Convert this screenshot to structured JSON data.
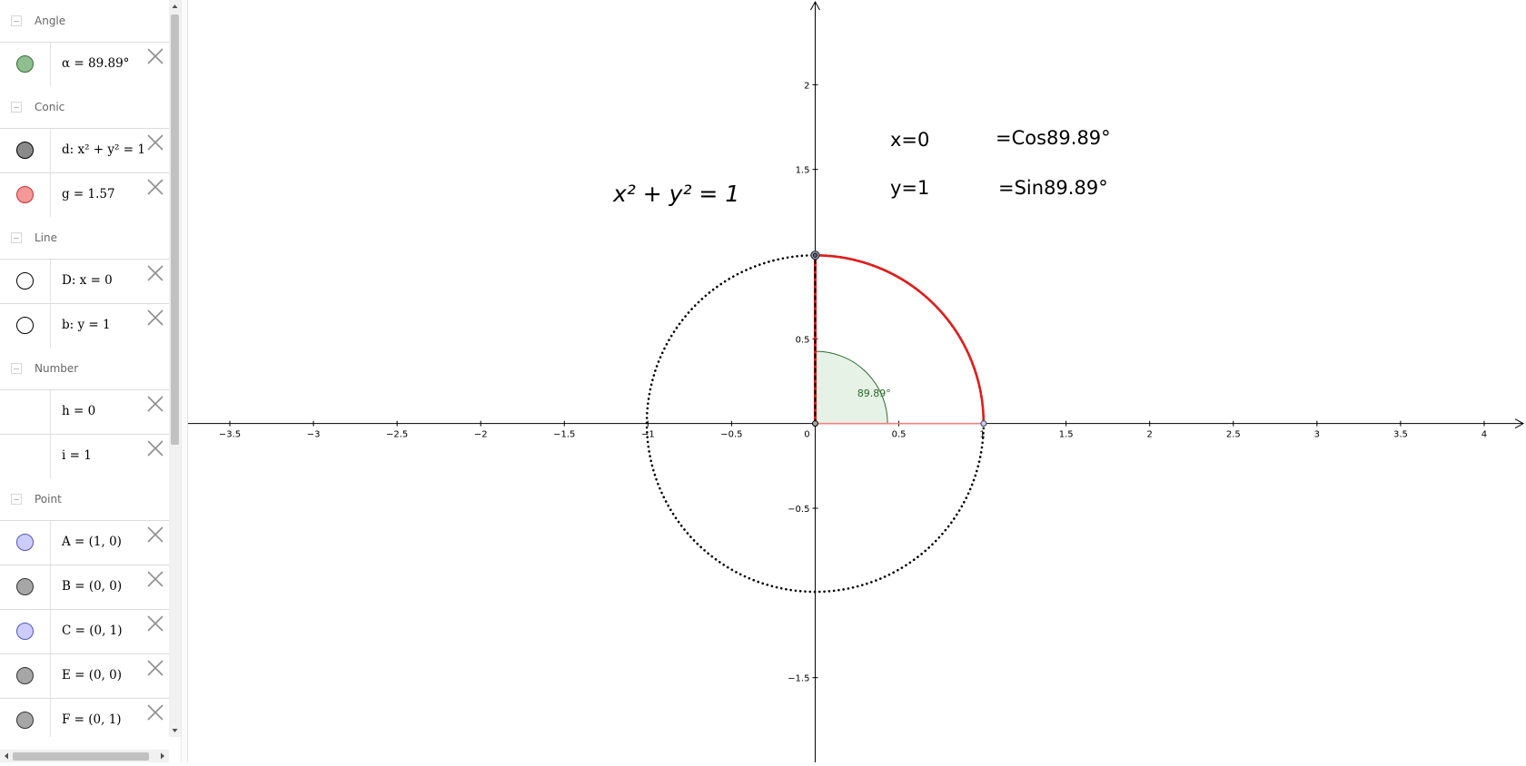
{
  "algebra": {
    "groups": [
      {
        "title": "Angle",
        "items": [
          {
            "expr": "α = 89.89°",
            "color": "#8fbf8f",
            "border": "#3a6a3a"
          }
        ]
      },
      {
        "title": "Conic",
        "items": [
          {
            "expr": "d: x² + y² = 1",
            "color": "#8a8a8a",
            "border": "#000000"
          },
          {
            "expr": "g = 1.57",
            "color": "#f49797",
            "border": "#c92f2f"
          }
        ]
      },
      {
        "title": "Line",
        "items": [
          {
            "expr": "D: x = 0",
            "color": "#ffffff",
            "border": "#000000"
          },
          {
            "expr": "b: y = 1",
            "color": "#ffffff",
            "border": "#000000"
          }
        ]
      },
      {
        "title": "Number",
        "items": [
          {
            "expr": "h = 0",
            "color": null,
            "border": null
          },
          {
            "expr": "i = 1",
            "color": null,
            "border": null
          }
        ]
      },
      {
        "title": "Point",
        "items": [
          {
            "expr": "A = (1, 0)",
            "color": "#ccccff",
            "border": "#5555c0"
          },
          {
            "expr": "B = (0, 0)",
            "color": "#a6a6a6",
            "border": "#333333"
          },
          {
            "expr": "C = (0, 1)",
            "color": "#ccccff",
            "border": "#5555c0"
          },
          {
            "expr": "E = (0, 0)",
            "color": "#a6a6a6",
            "border": "#333333"
          },
          {
            "expr": "F = (0, 1)",
            "color": "#a6a6a6",
            "border": "#333333"
          }
        ]
      }
    ],
    "delete_icon": "close-icon",
    "collapse_icon": "minus-icon"
  },
  "graphics": {
    "x_range": [
      -3.75,
      4.25
    ],
    "y_range": [
      -2.0,
      2.5
    ],
    "x_ticks": [
      "-3.5",
      "-3",
      "-2.5",
      "-2",
      "-1.5",
      "-1",
      "-0.5",
      "0",
      "0.5",
      "1",
      "1.5",
      "2",
      "2.5",
      "3",
      "3.5",
      "4"
    ],
    "y_ticks": [
      "-1.5",
      "-0.5",
      "0.5",
      "1.5",
      "2"
    ],
    "equation": "x² + y² = 1",
    "text_x": "x=0",
    "text_cos": "=Cos89.89°",
    "text_y": "y=1",
    "text_sin": "=Sin89.89°",
    "angle_label": "89.89°",
    "angle_deg": 89.89,
    "colors": {
      "arc": "#e31c1c",
      "angle_fill": "#e5f2e5",
      "angle_stroke": "#2e6b2e",
      "angle_text": "#2a6a2a",
      "axis": "#000000"
    }
  }
}
